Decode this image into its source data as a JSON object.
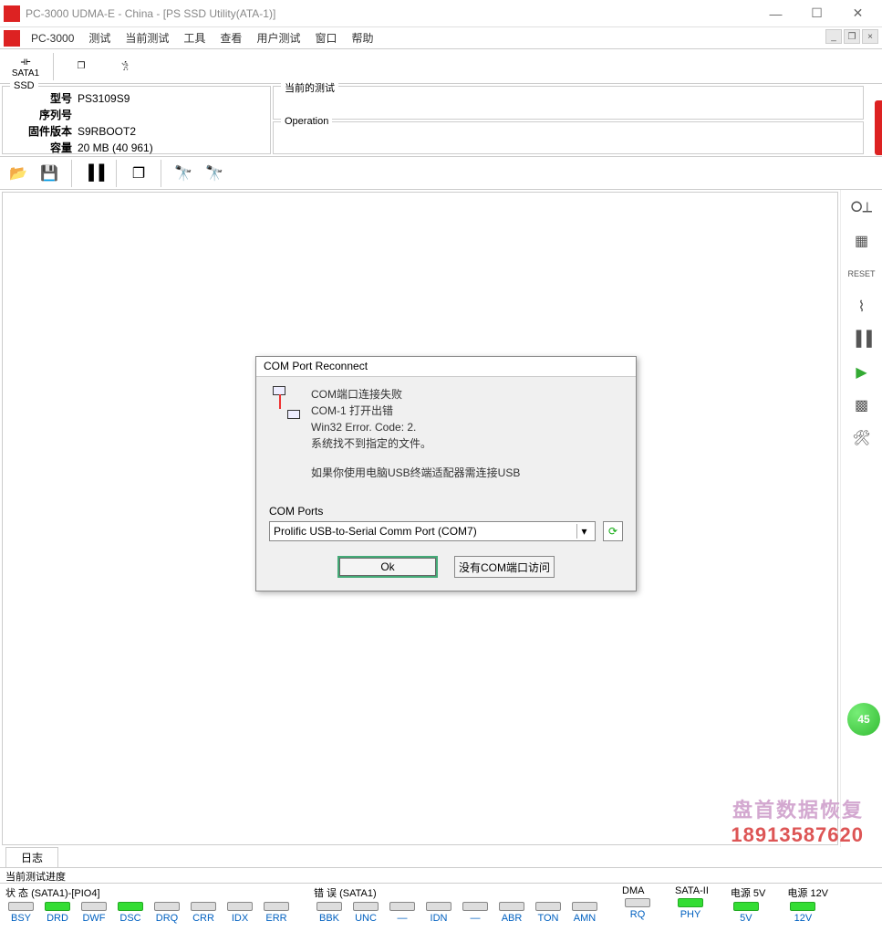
{
  "window": {
    "title": "PC-3000 UDMA-E - China - [PS SSD Utility(ATA-1)]"
  },
  "menu": {
    "app": "PC-3000",
    "items": [
      "测试",
      "当前测试",
      "工具",
      "查看",
      "用户测试",
      "窗口",
      "帮助"
    ]
  },
  "toolbar1": {
    "sata_label": "SATA1"
  },
  "ssd": {
    "group": "SSD",
    "model_label": "型号",
    "model": "PS3109S9",
    "serial_label": "序列号",
    "serial": "",
    "fw_label": "固件版本",
    "fw": "S9RBOOT2",
    "cap_label": "容量",
    "cap": "20 MB (40 961)"
  },
  "panels": {
    "current_test": "当前的测试",
    "operation": "Operation"
  },
  "tab": {
    "log": "日志"
  },
  "progress": {
    "label": "当前测试进度"
  },
  "status": {
    "group1": "状 态 (SATA1)-[PIO4]",
    "group2": "错 误 (SATA1)",
    "group3": "DMA",
    "group4": "SATA-II",
    "group5": "电源 5V",
    "group6": "电源 12V",
    "g1": [
      {
        "lbl": "BSY",
        "on": false
      },
      {
        "lbl": "DRD",
        "on": true
      },
      {
        "lbl": "DWF",
        "on": false
      },
      {
        "lbl": "DSC",
        "on": true
      },
      {
        "lbl": "DRQ",
        "on": false
      },
      {
        "lbl": "CRR",
        "on": false
      },
      {
        "lbl": "IDX",
        "on": false
      },
      {
        "lbl": "ERR",
        "on": false
      }
    ],
    "g2": [
      {
        "lbl": "BBK",
        "on": false
      },
      {
        "lbl": "UNC",
        "on": false
      },
      {
        "lbl": "—",
        "on": false
      },
      {
        "lbl": "IDN",
        "on": false
      },
      {
        "lbl": "—",
        "on": false
      },
      {
        "lbl": "ABR",
        "on": false
      },
      {
        "lbl": "TON",
        "on": false
      },
      {
        "lbl": "AMN",
        "on": false
      }
    ],
    "g3": [
      {
        "lbl": "RQ",
        "on": false
      }
    ],
    "g4": [
      {
        "lbl": "PHY",
        "on": true
      }
    ],
    "g5": [
      {
        "lbl": "5V",
        "on": true
      }
    ],
    "g6": [
      {
        "lbl": "12V",
        "on": true
      }
    ]
  },
  "dialog": {
    "title": "COM Port Reconnect",
    "line1": "COM端口连接失败",
    "line2": "COM-1 打开出错",
    "line3": "Win32 Error.  Code: 2.",
    "line4": "系统找不到指定的文件。",
    "line5": "如果你使用电脑USB终端适配器需连接USB",
    "ports_label": "COM Ports",
    "selected_port": "Prolific USB-to-Serial Comm Port (COM7)",
    "ok": "Ok",
    "no_access": "没有COM端口访问"
  },
  "watermark": {
    "text1": "盘首数据恢复",
    "text2": "18913587620"
  },
  "badge": {
    "text": "45"
  }
}
